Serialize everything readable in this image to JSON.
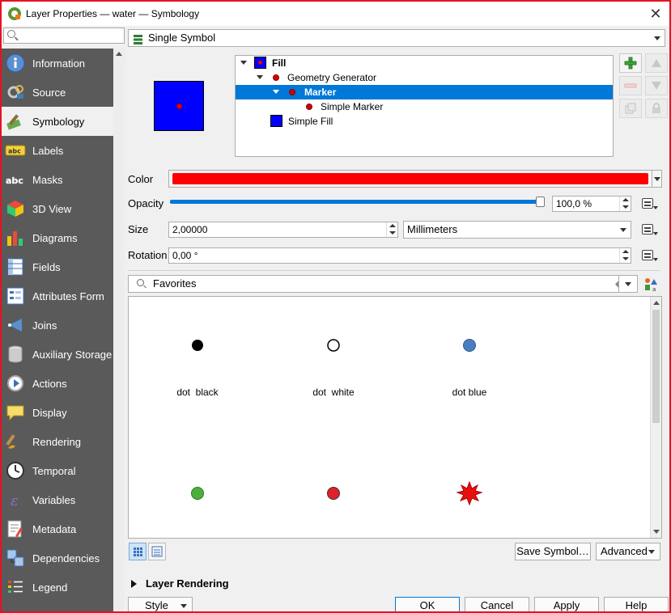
{
  "window": {
    "title": "Layer Properties — water — Symbology"
  },
  "sidebar": {
    "search_placeholder": "",
    "items": [
      {
        "label": "Information",
        "icon": "information-icon"
      },
      {
        "label": "Source",
        "icon": "source-icon"
      },
      {
        "label": "Symbology",
        "icon": "symbology-icon",
        "selected": true
      },
      {
        "label": "Labels",
        "icon": "labels-icon"
      },
      {
        "label": "Masks",
        "icon": "masks-icon"
      },
      {
        "label": "3D View",
        "icon": "3d-view-icon"
      },
      {
        "label": "Diagrams",
        "icon": "diagrams-icon"
      },
      {
        "label": "Fields",
        "icon": "fields-icon"
      },
      {
        "label": "Attributes Form",
        "icon": "attributes-form-icon"
      },
      {
        "label": "Joins",
        "icon": "joins-icon"
      },
      {
        "label": "Auxiliary Storage",
        "icon": "auxiliary-storage-icon"
      },
      {
        "label": "Actions",
        "icon": "actions-icon"
      },
      {
        "label": "Display",
        "icon": "display-icon"
      },
      {
        "label": "Rendering",
        "icon": "rendering-icon"
      },
      {
        "label": "Temporal",
        "icon": "temporal-icon"
      },
      {
        "label": "Variables",
        "icon": "variables-icon"
      },
      {
        "label": "Metadata",
        "icon": "metadata-icon"
      },
      {
        "label": "Dependencies",
        "icon": "dependencies-icon"
      },
      {
        "label": "Legend",
        "icon": "legend-icon"
      }
    ]
  },
  "renderer": {
    "selected": "Single Symbol"
  },
  "symbol_tree": [
    {
      "label": "Fill",
      "bold": true
    },
    {
      "label": "Geometry Generator",
      "bold": false
    },
    {
      "label": "Marker",
      "bold": true,
      "selected": true
    },
    {
      "label": "Simple Marker",
      "bold": false
    },
    {
      "label": "Simple Fill",
      "bold": false
    }
  ],
  "props": {
    "color_label": "Color",
    "color_value": "#ff0000",
    "opacity_label": "Opacity",
    "opacity_value": "100,0 %",
    "opacity_fraction": 1.0,
    "size_label": "Size",
    "size_value": "2,00000",
    "size_unit": "Millimeters",
    "rotation_label": "Rotation",
    "rotation_value": "0,00 °"
  },
  "library": {
    "filter": "Favorites",
    "items": [
      {
        "label": "dot  black",
        "color": "#000000"
      },
      {
        "label": "dot  white",
        "color": "#ffffff"
      },
      {
        "label": "dot blue",
        "color": "#4a7fbf"
      },
      {
        "label": "",
        "color": "#4caf3c"
      },
      {
        "label": "",
        "color": "#e0202a"
      },
      {
        "label": "",
        "color": "#e8100f"
      }
    ]
  },
  "buttons": {
    "save_symbol": "Save Symbol…",
    "advanced": "Advanced",
    "style": "Style",
    "ok": "OK",
    "cancel": "Cancel",
    "apply": "Apply",
    "help": "Help"
  },
  "sections": {
    "layer_rendering": "Layer Rendering"
  },
  "colors": {
    "accent": "#0078d7",
    "sidebar_bg": "#5a5a5a",
    "frame": "#e81123"
  }
}
